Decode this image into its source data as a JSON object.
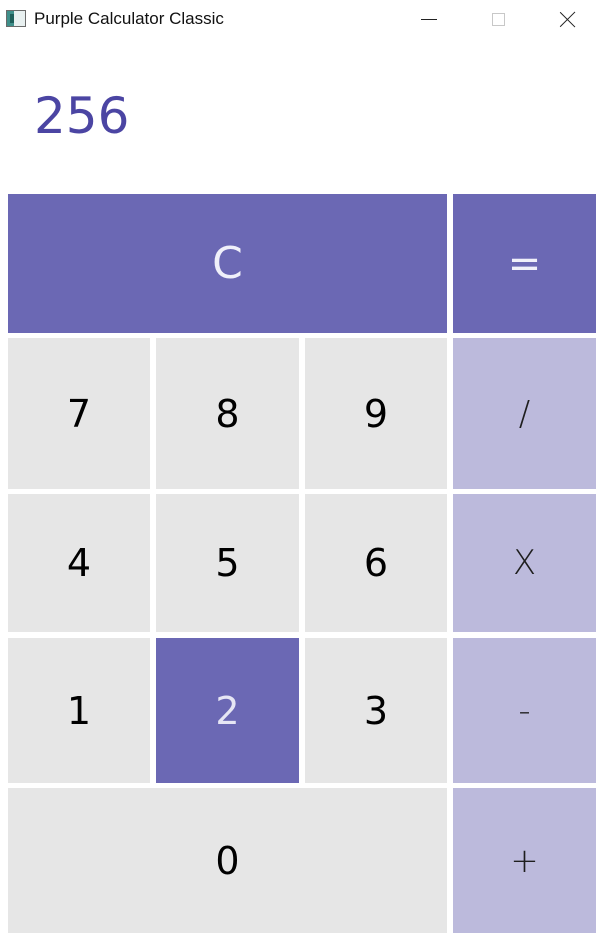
{
  "window": {
    "title": "Purple Calculator Classic",
    "icon": "calculator-app-icon",
    "controls": {
      "minimize_icon": "minimize-icon",
      "maximize_icon": "maximize-icon",
      "close_icon": "close-icon"
    }
  },
  "display": {
    "value": "256"
  },
  "keys": {
    "clear": "C",
    "equals": "=",
    "seven": "7",
    "eight": "8",
    "nine": "9",
    "divide": "/",
    "four": "4",
    "five": "5",
    "six": "6",
    "multiply": "X",
    "one": "1",
    "two": "2",
    "three": "3",
    "subtract": "-",
    "zero": "0",
    "add": "+"
  },
  "colors": {
    "accent": "#6b68b4",
    "operator": "#bcbadc",
    "number_key": "#e6e6e6",
    "display_text": "#4b45a3"
  },
  "state": {
    "pressed_key": "2"
  }
}
